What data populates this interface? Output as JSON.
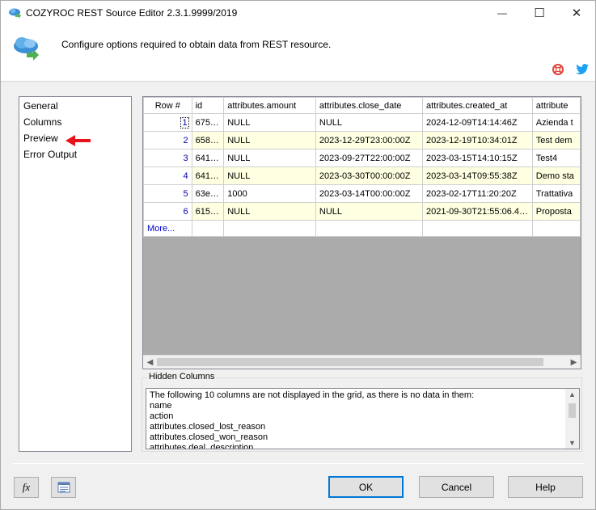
{
  "window": {
    "title": "COZYROC REST Source Editor 2.3.1.9999/2019",
    "minimize_glyph": "—",
    "maximize_glyph": "☐",
    "close_glyph": "✕"
  },
  "header": {
    "description": "Configure options required to obtain data from REST resource."
  },
  "nav": {
    "items": [
      "General",
      "Columns",
      "Preview",
      "Error Output"
    ]
  },
  "grid": {
    "columns": [
      "Row #",
      "id",
      "attributes.amount",
      "attributes.close_date",
      "attributes.created_at",
      "attribute"
    ],
    "rows": [
      [
        "1",
        "675…",
        "NULL",
        "NULL",
        "2024-12-09T14:14:46Z",
        "Azienda t"
      ],
      [
        "2",
        "658…",
        "NULL",
        "2023-12-29T23:00:00Z",
        "2023-12-19T10:34:01Z",
        "Test dem"
      ],
      [
        "3",
        "641…",
        "NULL",
        "2023-09-27T22:00:00Z",
        "2023-03-15T14:10:15Z",
        "Test4"
      ],
      [
        "4",
        "641…",
        "NULL",
        "2023-03-30T00:00:00Z",
        "2023-03-14T09:55:38Z",
        "Demo sta"
      ],
      [
        "5",
        "63e…",
        "1000",
        "2023-03-14T00:00:00Z",
        "2023-02-17T11:20:20Z",
        "Trattativa"
      ],
      [
        "6",
        "615…",
        "NULL",
        "NULL",
        "2021-09-30T21:55:06.4…",
        "Proposta"
      ]
    ],
    "more_label": "More..."
  },
  "hidden_columns": {
    "legend": "Hidden Columns",
    "lines": [
      "The following 10 columns are not displayed in the grid, as there is no data in them:",
      "name",
      "action",
      "attributes.closed_lost_reason",
      "attributes.closed_won_reason",
      "attributes.deal_description"
    ]
  },
  "footer": {
    "fx_label": "fx",
    "ok_label": "OK",
    "cancel_label": "Cancel",
    "help_label": "Help"
  },
  "colors": {
    "accent": "#0078d7",
    "arrow": "#e8121b",
    "even_row": "#ffffe1"
  }
}
